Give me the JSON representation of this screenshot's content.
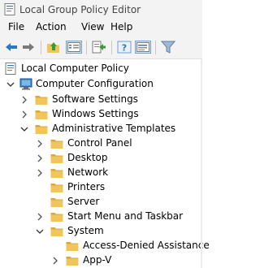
{
  "window": {
    "title": "Local Group Policy Editor"
  },
  "menu": {
    "file": "File",
    "action": "Action",
    "view": "View",
    "help": "Help"
  },
  "tree": {
    "root": "Local Computer Policy",
    "computer_config": "Computer Configuration",
    "software_settings": "Software Settings",
    "windows_settings": "Windows Settings",
    "admin_templates": "Administrative Templates",
    "control_panel": "Control Panel",
    "desktop": "Desktop",
    "network": "Network",
    "printers": "Printers",
    "server": "Server",
    "start_menu": "Start Menu and Taskbar",
    "system": "System",
    "access_denied": "Access-Denied Assistance",
    "app_v": "App-V"
  },
  "icons": {
    "back": "back-arrow-icon",
    "forward": "forward-arrow-icon",
    "up": "up-folder-icon",
    "show_tree": "show-hide-tree-icon",
    "export": "export-list-icon",
    "help": "help-icon",
    "properties": "properties-icon",
    "filter": "filter-icon",
    "folder": "folder-icon",
    "computer": "computer-icon",
    "policy": "policy-document-icon"
  },
  "colors": {
    "folder": "#f2c55c",
    "folder_dark": "#d9a934",
    "accent_blue": "#2b79c2"
  }
}
